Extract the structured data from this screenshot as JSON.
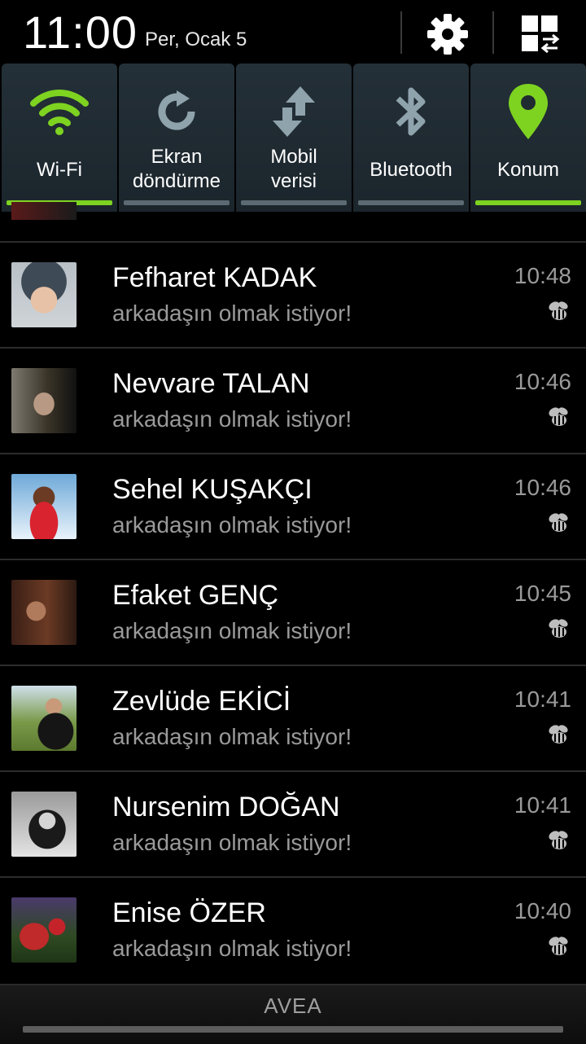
{
  "status": {
    "time": "11:00",
    "date": "Per, Ocak 5"
  },
  "header": {
    "settings_icon": "gear-icon",
    "edit_icon": "grid-swap-icon"
  },
  "toggles": [
    {
      "label_line1": "Wi-Fi",
      "label_line2": "",
      "active": true,
      "icon": "wifi-icon"
    },
    {
      "label_line1": "Ekran",
      "label_line2": "döndürme",
      "active": false,
      "icon": "rotate-icon"
    },
    {
      "label_line1": "Mobil",
      "label_line2": "verisi",
      "active": false,
      "icon": "mobile-data-icon"
    },
    {
      "label_line1": "Bluetooth",
      "label_line2": "",
      "active": false,
      "icon": "bluetooth-icon"
    },
    {
      "label_line1": "Konum",
      "label_line2": "",
      "active": true,
      "icon": "location-pin-icon"
    }
  ],
  "colors": {
    "active": "#7ed321",
    "inactive": "#5c6b73",
    "tile": "#1f2a31"
  },
  "notifications": [
    {
      "name": "Fefharet KADAK",
      "message": "arkadaşın olmak istiyor!",
      "time": "10:48"
    },
    {
      "name": "Nevvare TALAN",
      "message": "arkadaşın olmak istiyor!",
      "time": "10:46"
    },
    {
      "name": "Sehel KUŞAKÇI",
      "message": "arkadaşın olmak istiyor!",
      "time": "10:46"
    },
    {
      "name": "Efaket GENÇ",
      "message": "arkadaşın olmak istiyor!",
      "time": "10:45"
    },
    {
      "name": "Zevlüde EKİCİ",
      "message": "arkadaşın olmak istiyor!",
      "time": "10:41"
    },
    {
      "name": "Nursenim DOĞAN",
      "message": "arkadaşın olmak istiyor!",
      "time": "10:41"
    },
    {
      "name": "Enise ÖZER",
      "message": "arkadaşın olmak istiyor!",
      "time": "10:40"
    }
  ],
  "footer": {
    "carrier": "AVEA"
  }
}
